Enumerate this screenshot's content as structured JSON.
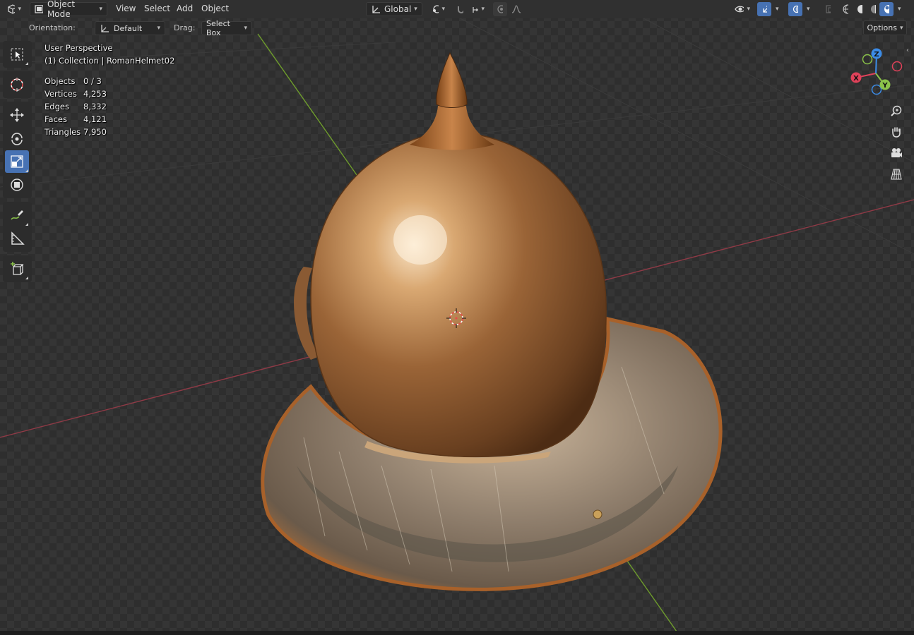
{
  "header": {
    "editor_type_icon": "3d-viewport-icon",
    "mode": "Object Mode",
    "menus": [
      "View",
      "Select",
      "Add",
      "Object"
    ],
    "transform_orientation": "Global"
  },
  "tool_settings": {
    "orientation_label": "Orientation:",
    "orientation_value": "Default",
    "drag_label": "Drag:",
    "drag_value": "Select Box",
    "options_label": "Options"
  },
  "toolbar": {
    "tools": [
      "select-box",
      "cursor",
      "move",
      "rotate",
      "scale",
      "transform",
      "annotate",
      "measure",
      "add-cube"
    ],
    "active_tool": "scale"
  },
  "overlay": {
    "view_name": "User Perspective",
    "collection": "(1) Collection | RomanHelmet02",
    "stats": [
      {
        "label": "Objects",
        "value": "0 / 3"
      },
      {
        "label": "Vertices",
        "value": "4,253"
      },
      {
        "label": "Edges",
        "value": "8,332"
      },
      {
        "label": "Faces",
        "value": "4,121"
      },
      {
        "label": "Triangles",
        "value": "7,950"
      }
    ]
  },
  "gizmo": {
    "axes": [
      "X",
      "Y",
      "Z"
    ],
    "colors": {
      "x": "#e0425a",
      "y": "#8bc34a",
      "z": "#3c8ce7"
    }
  },
  "nav_buttons": [
    "zoom-icon",
    "hand-pan-icon",
    "camera-icon",
    "ortho-grid-icon"
  ],
  "colors": {
    "accent": "#4772b3",
    "x_axis_line": "#9a3a44",
    "y_axis_line": "#6a9a2a",
    "helmet_bronze": "#b07848"
  }
}
